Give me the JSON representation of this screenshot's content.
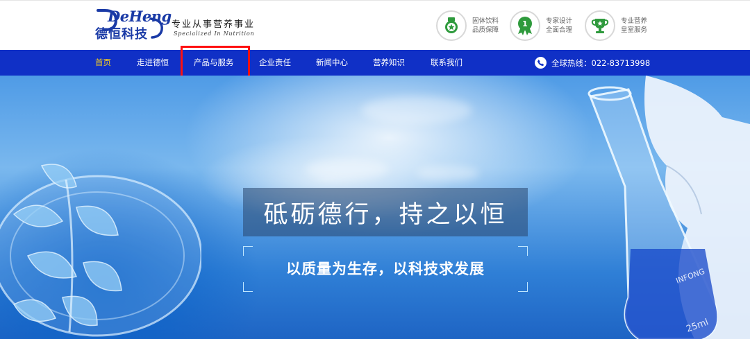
{
  "header": {
    "logo_en": "DeHeng",
    "logo_cn": "德恒科技",
    "slogan_cn": "专业从事营养事业",
    "slogan_en": "Specialized In Nutrition",
    "badges": [
      {
        "icon": "medal-icon",
        "line1": "固体饮料",
        "line2": "品质保障"
      },
      {
        "icon": "award-ribbon-icon",
        "line1": "专家设计",
        "line2": "全面合理"
      },
      {
        "icon": "trophy-icon",
        "line1": "专业营养",
        "line2": "皇室服务"
      }
    ]
  },
  "nav": {
    "items": [
      {
        "label": "首页",
        "active": true
      },
      {
        "label": "走进德恒",
        "active": false
      },
      {
        "label": "产品与服务",
        "active": false
      },
      {
        "label": "企业责任",
        "active": false
      },
      {
        "label": "新闻中心",
        "active": false
      },
      {
        "label": "营养知识",
        "active": false
      },
      {
        "label": "联系我们",
        "active": false
      }
    ],
    "hotline": "全球热线：022-83713998"
  },
  "banner": {
    "title": "砥砺德行，持之以恒",
    "subtitle": "以质量为生存，以科技求发展"
  },
  "colors": {
    "nav_bg": "#1030c6",
    "brand_blue": "#1a3aa6",
    "active_nav": "#ffd21a",
    "badge_green": "#2e9a3c",
    "highlight": "#ff1010"
  }
}
